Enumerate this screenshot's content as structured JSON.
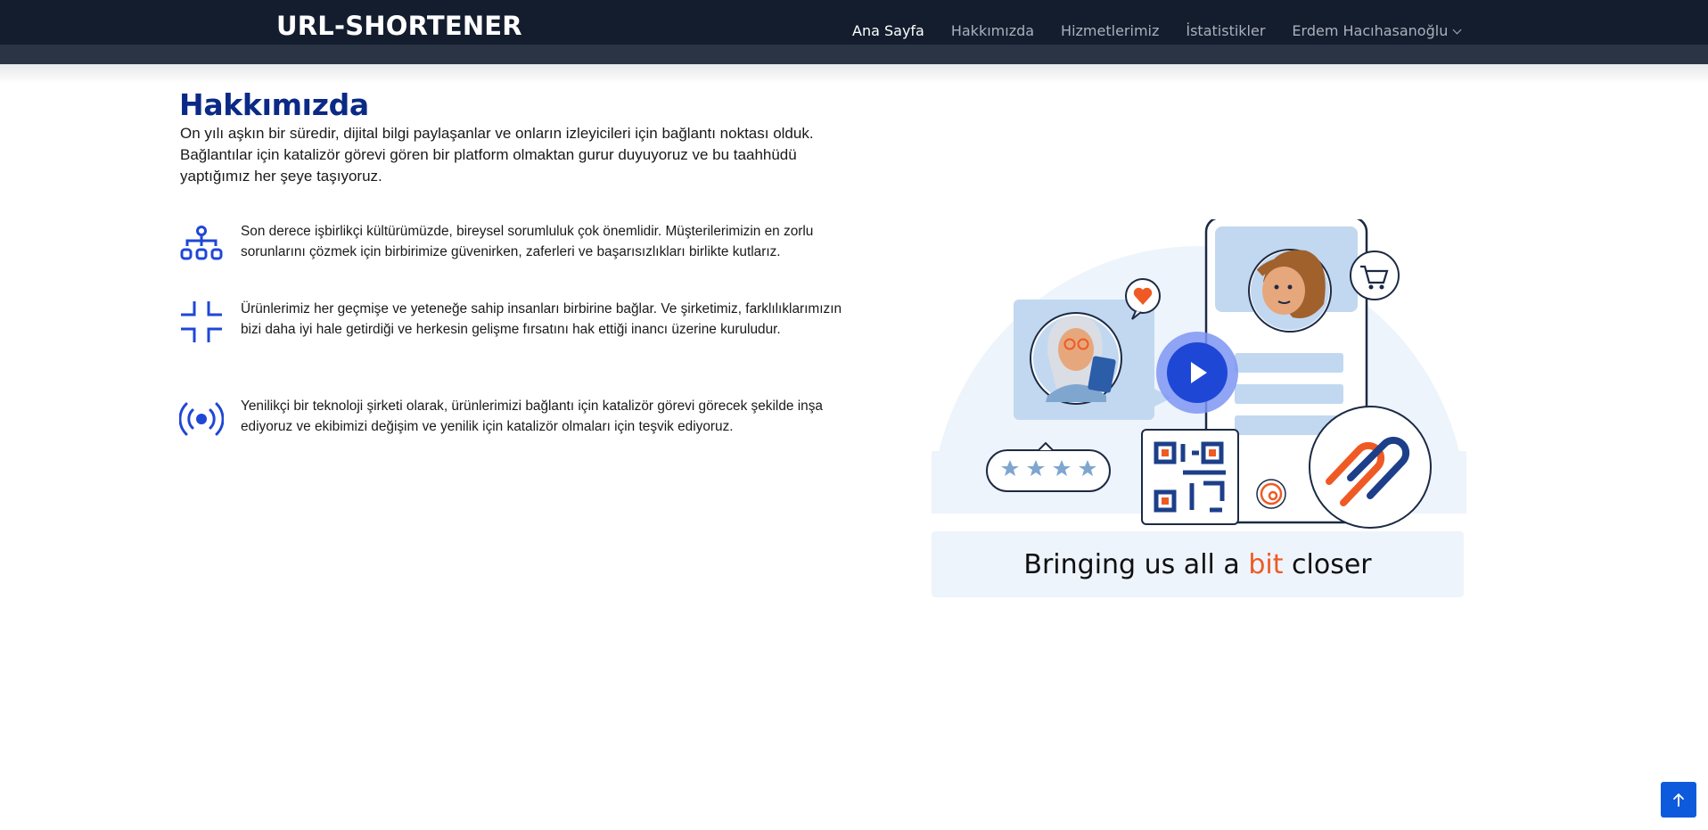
{
  "header": {
    "brand": "URL-SHORTENER",
    "nav": [
      {
        "label": "Ana Sayfa",
        "active": true
      },
      {
        "label": "Hakkımızda",
        "active": false
      },
      {
        "label": "Hizmetlerimiz",
        "active": false
      },
      {
        "label": "İstatistikler",
        "active": false
      },
      {
        "label": "Erdem Hacıhasanoğlu",
        "active": false,
        "dropdown": true
      }
    ]
  },
  "about": {
    "title": "Hakkımızda",
    "intro": "On yılı aşkın bir süredir, dijital bilgi paylaşanlar ve onların izleyicileri için bağlantı noktası olduk. Bağlantılar için katalizör görevi gören bir platform olmaktan gurur duyuyoruz ve bu taahhüdü yaptığımız her şeye taşıyoruz.",
    "features": [
      {
        "icon": "sitemap-icon",
        "text": "Son derece işbirlikçi kültürümüzde, bireysel sorumluluk çok önemlidir. Müşterilerimizin en zorlu sorunlarını çözmek için birbirimize güvenirken, zaferleri ve başarısızlıkları birlikte kutlarız."
      },
      {
        "icon": "collapse-corners-icon",
        "text": "Ürünlerimiz her geçmişe ve yeteneğe sahip insanları birbirine bağlar. Ve şirketimiz, farklılıklarımızın bizi daha iyi hale getirdiği ve herkesin gelişme fırsatını hak ettiği inancı üzerine kuruludur."
      },
      {
        "icon": "broadcast-icon",
        "text": "Yenilikçi bir teknoloji şirketi olarak, ürünlerimizi bağlantı için katalizör görevi görecek şekilde inşa ediyoruz ve ekibimizi değişim ve yenilik için katalizör olmaları için teşvik ediyoruz."
      }
    ]
  },
  "illustration": {
    "caption_before": "Bringing us all a ",
    "caption_accent": "bit",
    "caption_after": " closer"
  },
  "colors": {
    "header_bg": "#141d2e",
    "title_blue": "#0b2a86",
    "icon_blue": "#1f47d6",
    "accent_orange": "#ef5a24",
    "scroll_button": "#0d5bdc"
  },
  "scroll_top": {
    "icon": "arrow-up-icon"
  }
}
